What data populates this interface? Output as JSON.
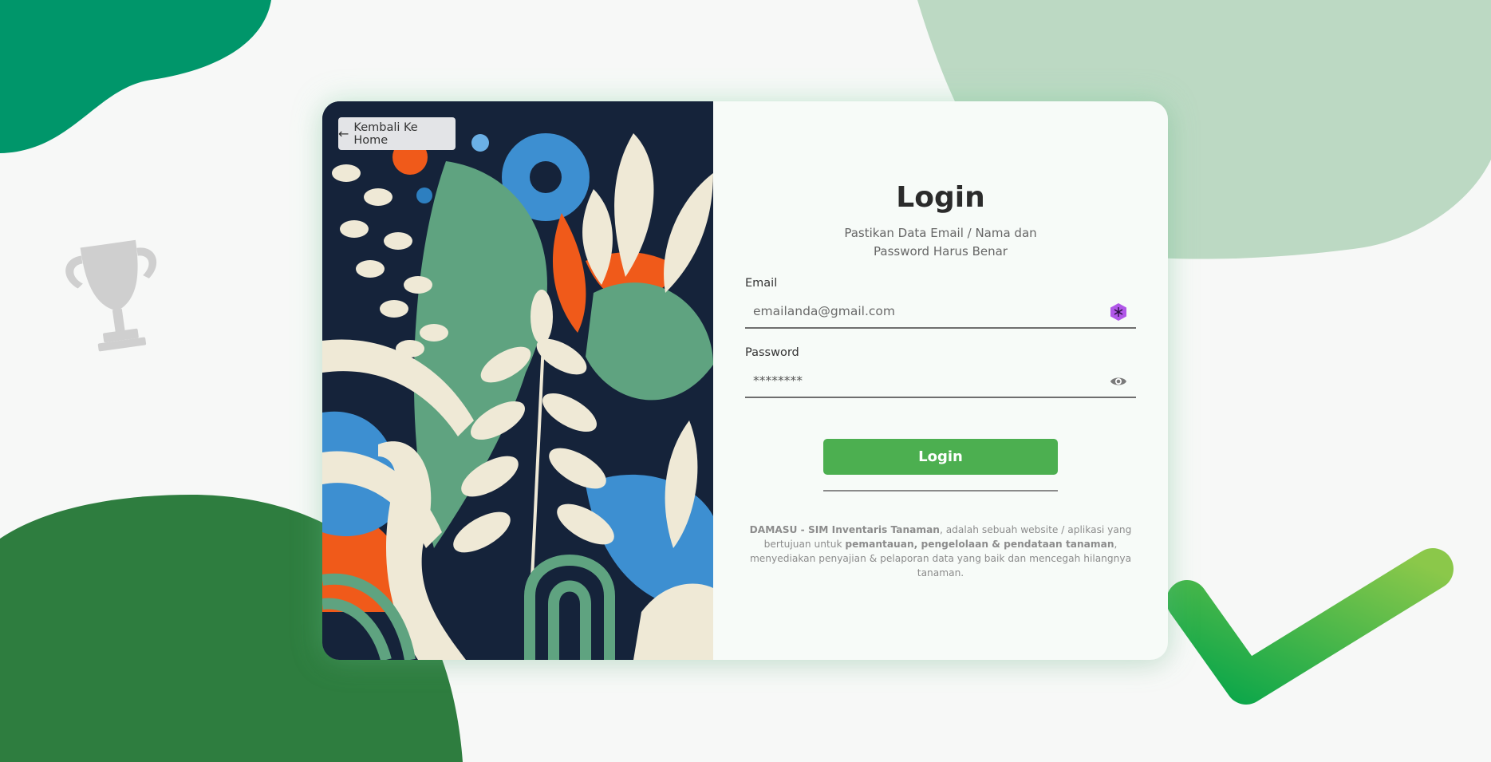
{
  "back_button": {
    "icon": "arrow-left-icon",
    "label": "Kembali Ke Home"
  },
  "login": {
    "title": "Login",
    "subtitle": "Pastikan Data Email / Nama dan Password Harus Benar",
    "email": {
      "label": "Email",
      "placeholder": "emailanda@gmail.com",
      "icon": "extension-badge-icon"
    },
    "password": {
      "label": "Password",
      "value": "********",
      "icon": "eye-icon"
    },
    "submit_label": "Login"
  },
  "footer": {
    "brand": "DAMASU - SIM Inventaris Tanaman",
    "text_1": ", adalah sebuah website / aplikasi yang bertujuan untuk ",
    "emphasis": "pemantauan, pengelolaan & pendataan tanaman",
    "text_2": ", menyediakan penyajian & pelaporan data yang baik dan mencegah hilangnya tanaman."
  },
  "colors": {
    "accent": "#4caf50",
    "blob_top_left": "#00966a",
    "blob_top_right": "#bcd9c3",
    "blob_bottom_left": "#2e7d3f",
    "art_background": "#15233a"
  }
}
